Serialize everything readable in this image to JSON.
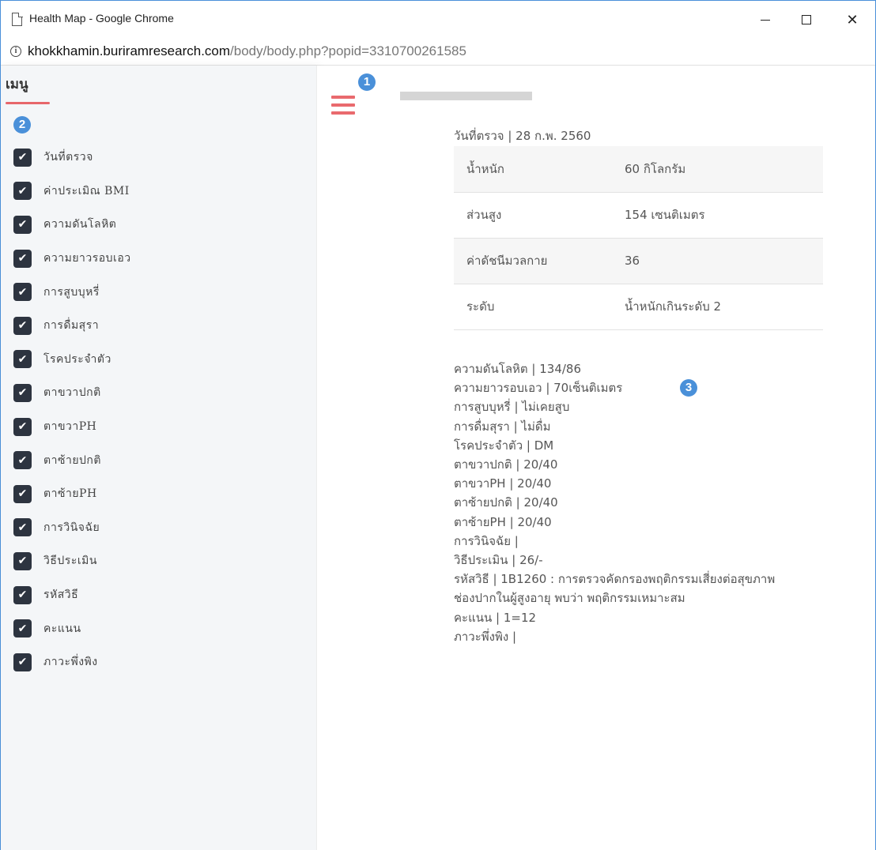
{
  "window": {
    "title": "Health Map - Google Chrome",
    "minimize_icon": "minimize-icon",
    "maximize_icon": "maximize-icon",
    "close_glyph": "✕"
  },
  "address_bar": {
    "info_glyph": "i",
    "host": "khokkhamin.buriramresearch.com",
    "path": "/body/body.php?popid=3310700261585"
  },
  "sidebar": {
    "title": "เมนู",
    "badge": "2",
    "check_glyph": "✔",
    "items": [
      {
        "label": "วันที่ตรวจ",
        "checked": true
      },
      {
        "label": "ค่าประเมิณ BMI",
        "checked": true
      },
      {
        "label": "ความดันโลหิต",
        "checked": true
      },
      {
        "label": "ความยาวรอบเอว",
        "checked": true
      },
      {
        "label": "การสูบบุหรี่",
        "checked": true
      },
      {
        "label": "การดื่มสุรา",
        "checked": true
      },
      {
        "label": "โรคประจำตัว",
        "checked": true
      },
      {
        "label": "ตาขวาปกติ",
        "checked": true
      },
      {
        "label": "ตาขวาPH",
        "checked": true
      },
      {
        "label": "ตาซ้ายปกติ",
        "checked": true
      },
      {
        "label": "ตาซ้ายPH",
        "checked": true
      },
      {
        "label": "การวินิจฉัย",
        "checked": true
      },
      {
        "label": "วิธีประเมิน",
        "checked": true
      },
      {
        "label": "รหัสวิธี",
        "checked": true
      },
      {
        "label": "คะแนน",
        "checked": true
      },
      {
        "label": "ภาวะพึ่งพิง",
        "checked": true
      }
    ]
  },
  "main": {
    "badge_1": "1",
    "badge_3": "3",
    "date_line": "วันที่ตรวจ |  28 ก.พ. 2560",
    "bmi_table": [
      {
        "key": "น้ำหนัก",
        "value": "60  กิโลกรัม"
      },
      {
        "key": "ส่วนสูง",
        "value": "154  เซนติเมตร"
      },
      {
        "key": "ค่าดัชนีมวลกาย",
        "value": "36"
      },
      {
        "key": "ระดับ",
        "value": "น้ำหนักเกินระดับ 2"
      }
    ],
    "details": [
      "ความดันโลหิต |  134/86",
      "ความยาวรอบเอว |  70เซ็นติเมตร",
      "การสูบบุหรี่ |  ไม่เคยสูบ",
      "การดื่มสุรา |  ไม่ดื่ม",
      "โรคประจำตัว |  DM",
      "ตาขวาปกติ |  20/40",
      "ตาขวาPH |  20/40",
      "ตาซ้ายปกติ |  20/40",
      "ตาซ้ายPH |  20/40",
      "การวินิจฉัย |",
      "วิธีประเมิน |  26/-",
      "รหัสวิธี |  1B1260 : การตรวจคัดกรองพฤติกรรมเสี่ยงต่อสุขภาพ",
      "ช่องปากในผู้สูงอายุ พบว่า พฤติกรรมเหมาะสม",
      "คะแนน |  1=12",
      "ภาวะพึ่งพิง |"
    ]
  }
}
